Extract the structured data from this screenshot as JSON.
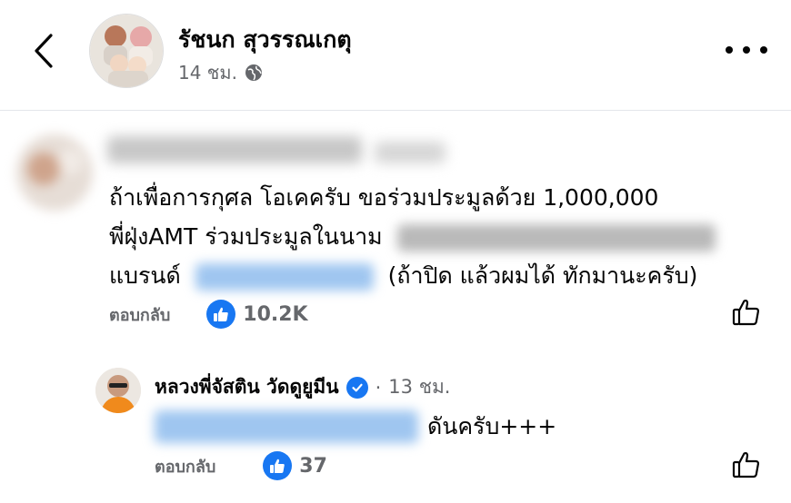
{
  "header": {
    "name": "รัชนก สุวรรณเกตุ",
    "time": "14 ชม.",
    "globe_icon": "globe-icon",
    "back_icon": "chevron-left-icon",
    "more_icon": "more-dots-icon"
  },
  "comment1": {
    "line1": "ถ้าเพื่อการกุศล โอเคครับ ขอร่วมประมูลด้วย 1,000,000",
    "line2_prefix": "พี่ฝุ่งAMT ร่วมประมูลในนาม",
    "line3_prefix": "แบรนด์",
    "line3_suffix": "(ถ้าปิด แล้วผมได้ ทักมานะครับ)",
    "reply_label": "ตอบกลับ",
    "like_count": "10.2K"
  },
  "comment2": {
    "name": "หลวงพี่จัสติน วัดดูยูมีน",
    "separator": "·",
    "time": "13 ชม.",
    "text": "ดันครับ+++",
    "reply_label": "ตอบกลับ",
    "like_count": "37"
  },
  "colors": {
    "accent": "#1877f2",
    "secondary_text": "#65676b",
    "divider": "#e4e6eb"
  }
}
